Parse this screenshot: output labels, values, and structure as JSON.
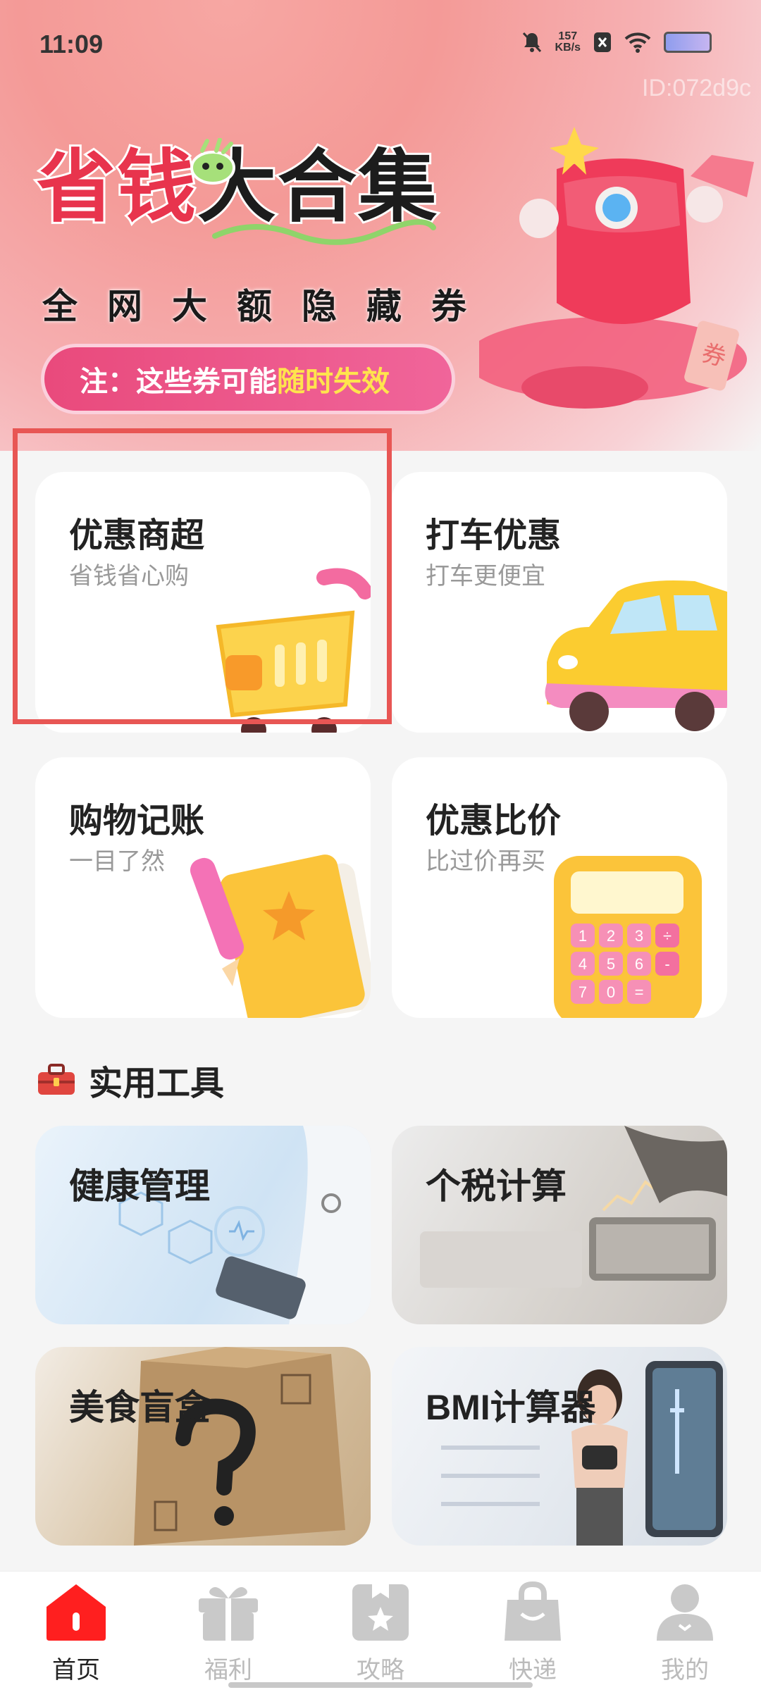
{
  "status_bar": {
    "time": "11:09",
    "speed_value": "157",
    "speed_unit": "KB/s"
  },
  "watermark": "ID:072d9c",
  "banner": {
    "title_red": "省钱",
    "title_black": "大合集",
    "subtitle": "全网大额隐藏券",
    "notice_prefix": "注：这些券可能",
    "notice_highlight": "随时失效",
    "ticket_label": "券"
  },
  "cards": [
    {
      "title": "优惠商超",
      "subtitle": "省钱省心购"
    },
    {
      "title": "打车优惠",
      "subtitle": "打车更便宜"
    },
    {
      "title": "购物记账",
      "subtitle": "一目了然"
    },
    {
      "title": "优惠比价",
      "subtitle": "比过价再买"
    }
  ],
  "calculator_keys": [
    "1",
    "2",
    "3",
    "÷",
    "4",
    "5",
    "6",
    "-",
    "7",
    "0",
    "="
  ],
  "tools_section": {
    "title": "实用工具"
  },
  "tools": [
    {
      "title": "健康管理"
    },
    {
      "title": "个税计算"
    },
    {
      "title": "美食盲盒"
    },
    {
      "title": "BMI计算器"
    }
  ],
  "tabbar": [
    {
      "label": "首页",
      "icon": "home-icon",
      "active": true
    },
    {
      "label": "福利",
      "icon": "gift-icon",
      "active": false
    },
    {
      "label": "攻略",
      "icon": "guide-icon",
      "active": false
    },
    {
      "label": "快递",
      "icon": "package-icon",
      "active": false
    },
    {
      "label": "我的",
      "icon": "profile-icon",
      "active": false
    }
  ],
  "colors": {
    "accent_red": "#ff1f1f",
    "highlight_border": "#e85654",
    "notice_yellow": "#ffe44d"
  }
}
